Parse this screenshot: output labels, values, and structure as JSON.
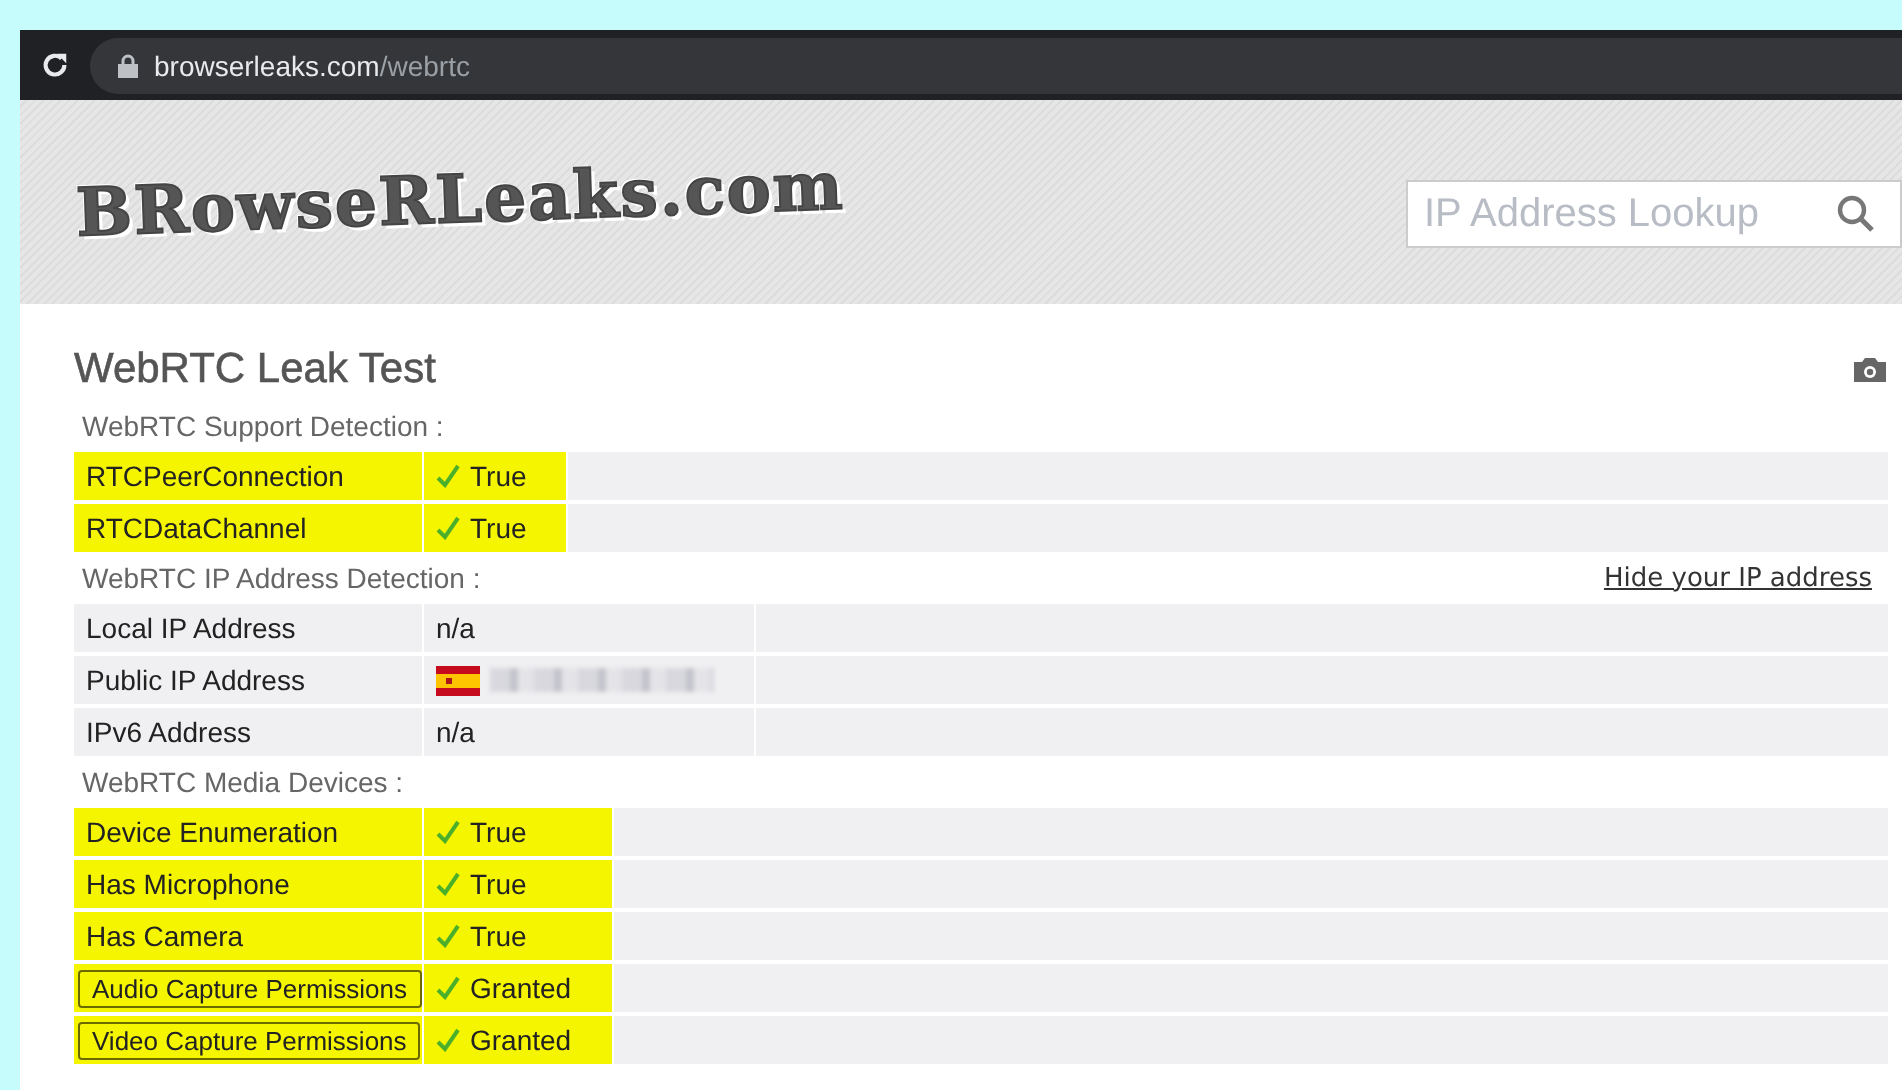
{
  "browser": {
    "url_host": "browserleaks.com",
    "url_path": "/webrtc"
  },
  "header": {
    "logo": "BRowseRLeaks.com",
    "search": {
      "placeholder": "IP Address Lookup"
    }
  },
  "page": {
    "title": "WebRTC Leak Test"
  },
  "sections": [
    {
      "title": "WebRTC Support Detection :",
      "rows": [
        {
          "label": "RTCPeerConnection",
          "boxed": false,
          "value": "True",
          "checked": true,
          "highlighted": true,
          "kind": "text"
        },
        {
          "label": "RTCDataChannel",
          "boxed": false,
          "value": "True",
          "checked": true,
          "highlighted": true,
          "kind": "text"
        }
      ]
    },
    {
      "title": "WebRTC IP Address Detection :",
      "link": "Hide your IP address",
      "rows": [
        {
          "label": "Local IP Address",
          "boxed": false,
          "value": "n/a",
          "checked": false,
          "highlighted": false,
          "kind": "text"
        },
        {
          "label": "Public IP Address",
          "boxed": false,
          "checked": false,
          "highlighted": false,
          "kind": "blurred-ip"
        },
        {
          "label": "IPv6 Address",
          "boxed": false,
          "value": "n/a",
          "checked": false,
          "highlighted": false,
          "kind": "text"
        }
      ]
    },
    {
      "title": "WebRTC Media Devices :",
      "rows": [
        {
          "label": "Device Enumeration",
          "boxed": false,
          "value": "True",
          "checked": true,
          "highlighted": true,
          "kind": "text"
        },
        {
          "label": "Has Microphone",
          "boxed": false,
          "value": "True",
          "checked": true,
          "highlighted": true,
          "kind": "text"
        },
        {
          "label": "Has Camera",
          "boxed": false,
          "value": "True",
          "checked": true,
          "highlighted": true,
          "kind": "text"
        },
        {
          "label": "Audio Capture Permissions",
          "boxed": true,
          "value": "Granted",
          "checked": true,
          "highlighted": true,
          "kind": "text"
        },
        {
          "label": "Video Capture Permissions",
          "boxed": true,
          "value": "Granted",
          "checked": true,
          "highlighted": true,
          "kind": "text"
        }
      ]
    }
  ]
}
